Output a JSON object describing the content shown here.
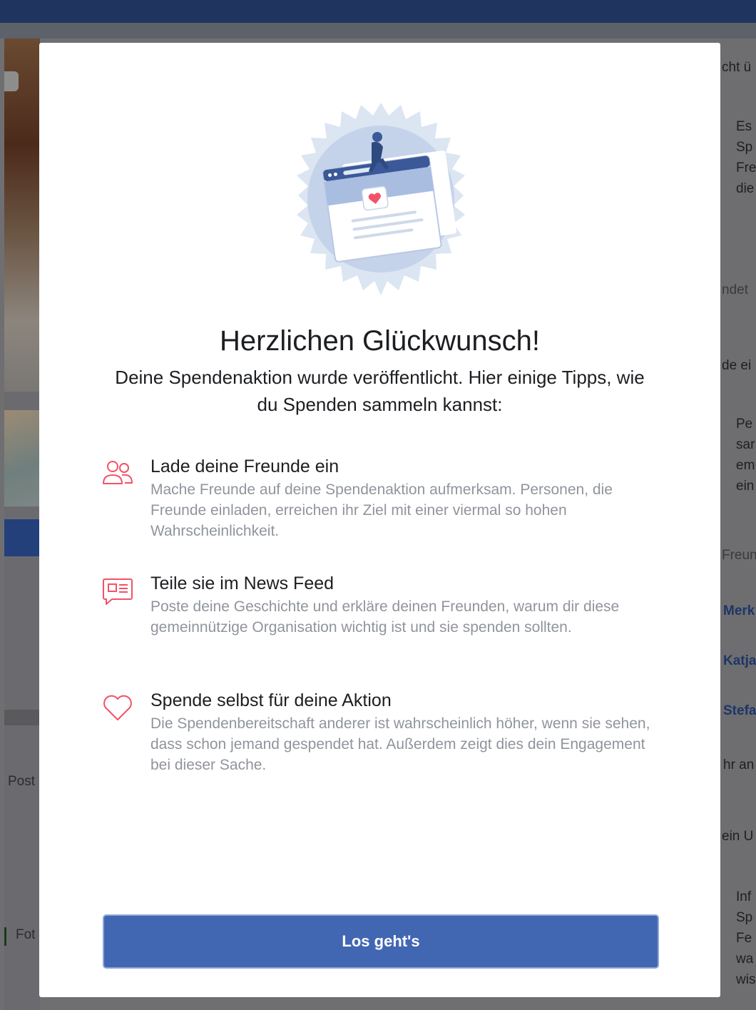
{
  "background": {
    "post_label": "Post",
    "foto_label": "Fot",
    "right_column": {
      "header_1": "cht ü",
      "body_1": [
        "Es",
        "Sp",
        "Fre",
        "die"
      ],
      "label_1": "ndet",
      "header_2": "de ei",
      "body_2": [
        "Pe",
        "sar",
        "em",
        "ein"
      ],
      "label_2": "Freun",
      "links": [
        "Merk",
        "Katja",
        "Stefa"
      ],
      "more": "hr an",
      "header_3": "ein U",
      "body_3": [
        "Inf",
        "Sp",
        "Fe",
        "wa",
        "wis"
      ]
    }
  },
  "modal": {
    "title": "Herzlichen Glückwunsch!",
    "subtitle": "Deine Spendenaktion wurde veröffentlicht. Hier einige Tipps, wie du Spenden sammeln kannst:",
    "tips": [
      {
        "icon": "people-icon",
        "title": "Lade deine Freunde ein",
        "body": "Mache Freunde auf deine Spendenaktion aufmerksam. Personen, die Freunde einladen, erreichen ihr Ziel mit einer viermal so hohen Wahrscheinlichkeit."
      },
      {
        "icon": "share-post-icon",
        "title": "Teile sie im News Feed",
        "body": "Poste deine Geschichte und erkläre deinen Freunden, warum dir diese gemeinnützige Organisation wichtig ist und sie spenden sollten."
      },
      {
        "icon": "heart-icon",
        "title": "Spende selbst für deine Aktion",
        "body": "Die Spendenbereitschaft anderer ist wahrscheinlich höher, wenn sie sehen, dass schon jemand gespendet hat. Außerdem zeigt dies dein Engagement bei dieser Sache."
      }
    ],
    "cta_label": "Los geht's"
  },
  "colors": {
    "accent": "#4267b2",
    "icon_pink": "#f25268",
    "muted_text": "#90949c"
  }
}
